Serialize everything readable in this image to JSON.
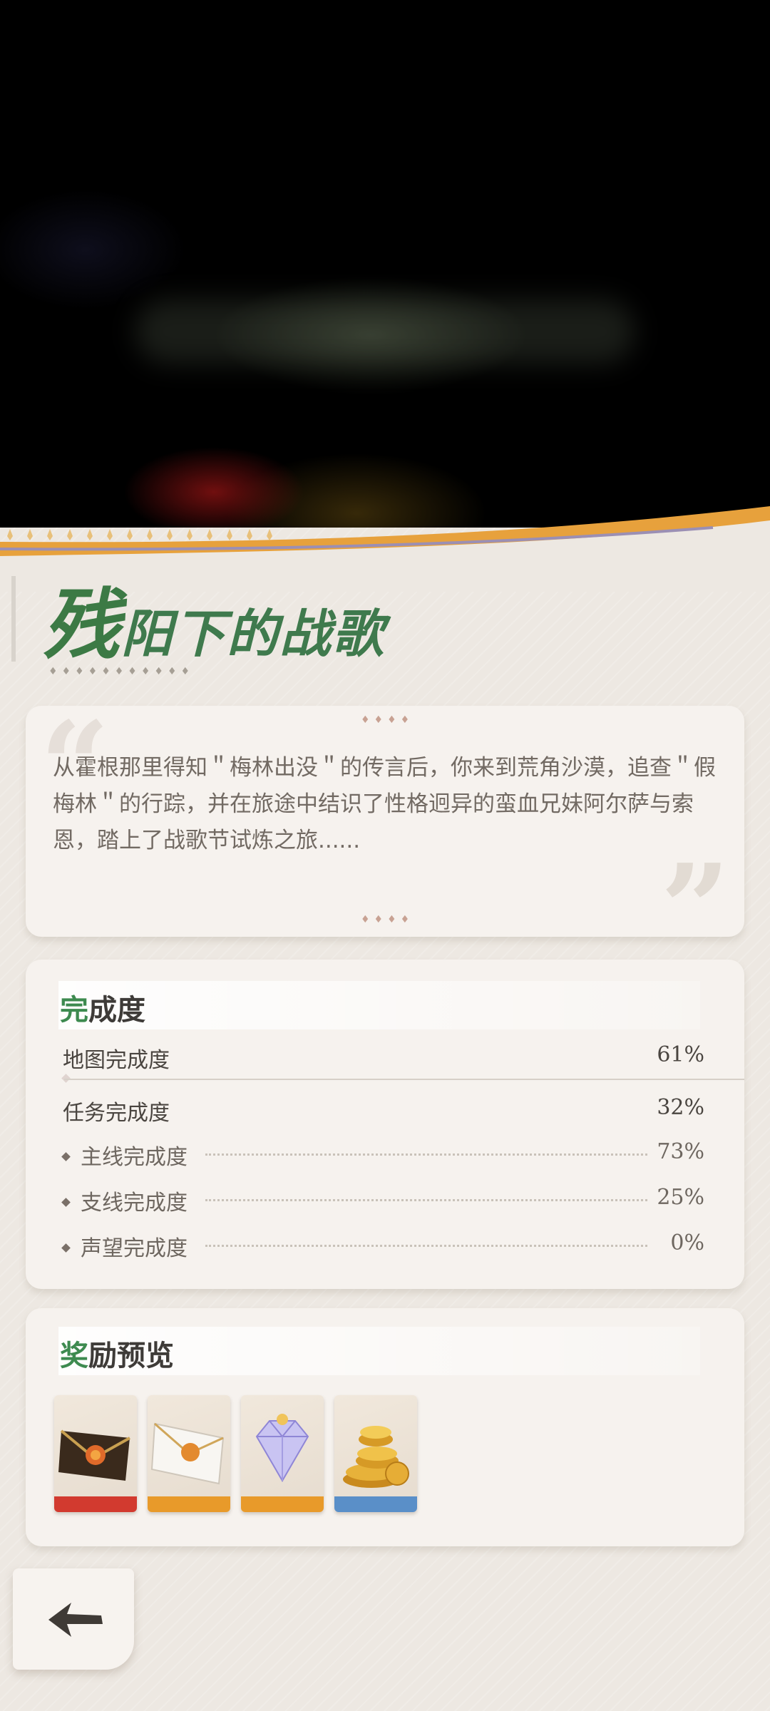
{
  "hero": {
    "image_desc": ""
  },
  "title": {
    "first_char": "残",
    "rest": "阳下的战歌"
  },
  "story": {
    "text": "从霍根那里得知＂梅林出没＂的传言后，你来到荒角沙漠，追查＂假梅林＂的行踪，并在旅途中结识了性格迥异的蛮血兄妹阿尔萨与索恩，踏上了战歌节试炼之旅......"
  },
  "completion": {
    "title_accent": "完",
    "title_rest": "成度",
    "map_label": "地图完成度",
    "map_value": "61%",
    "quest_label": "任务完成度",
    "quest_value": "32%",
    "sub": [
      {
        "label": "主线完成度",
        "value": "73%"
      },
      {
        "label": "支线完成度",
        "value": "25%"
      },
      {
        "label": "声望完成度",
        "value": "0%"
      }
    ]
  },
  "rewards": {
    "title_accent": "奖",
    "title_rest": "励预览",
    "items": [
      {
        "icon": "dark-envelope-icon",
        "bottom_color": "#d23a2f"
      },
      {
        "icon": "white-envelope-icon",
        "bottom_color": "#e89a2a"
      },
      {
        "icon": "crystal-gem-icon",
        "bottom_color": "#e89a2a"
      },
      {
        "icon": "gold-coins-icon",
        "bottom_color": "#5a8fc8"
      }
    ]
  },
  "colors": {
    "accent_green": "#3d8a4f",
    "wave_orange": "#e8a43a",
    "paper": "#ede8e2"
  }
}
